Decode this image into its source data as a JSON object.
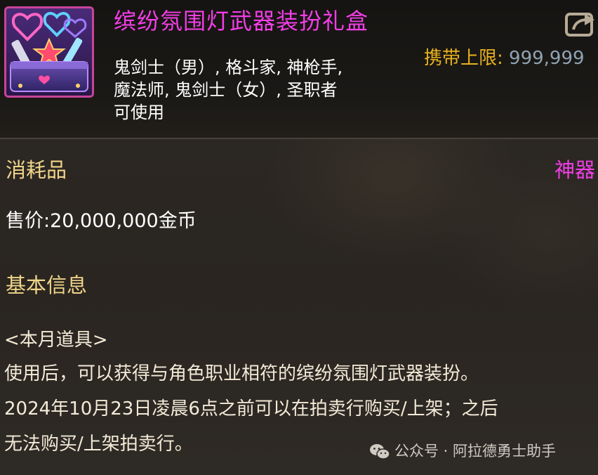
{
  "item": {
    "name": "缤纷氛围灯武器装扮礼盒",
    "icon": "gift-box-icon",
    "carry_limit_label": "携带上限:",
    "carry_limit_value": "999,999",
    "classes_lines": [
      "鬼剑士（男）, 格斗家, 神枪手,",
      "魔法师, 鬼剑士（女）, 圣职者",
      "可使用"
    ],
    "type": "消耗品",
    "rarity": "神器",
    "price_label": "售价:",
    "price_value": "20,000,000金币"
  },
  "basic_info": {
    "title": "基本信息",
    "lines": [
      "<本月道具>",
      "使用后，可以获得与角色职业相符的缤纷氛围灯武器装扮。",
      "2024年10月23日凌晨6点之前可以在拍卖行购买/上架；之后",
      "无法购买/上架拍卖行。"
    ]
  },
  "watermark": {
    "icon": "wechat-icon",
    "text": "公众号 · 阿拉德勇士助手"
  },
  "share": {
    "icon": "share-icon"
  },
  "colors": {
    "name": "#f23ee6",
    "rarity": "#f23ee6",
    "carry_label": "#e8b21e",
    "carry_value": "#8fa3b3",
    "section": "#f0d58a",
    "icon_border": "#c8449a"
  }
}
